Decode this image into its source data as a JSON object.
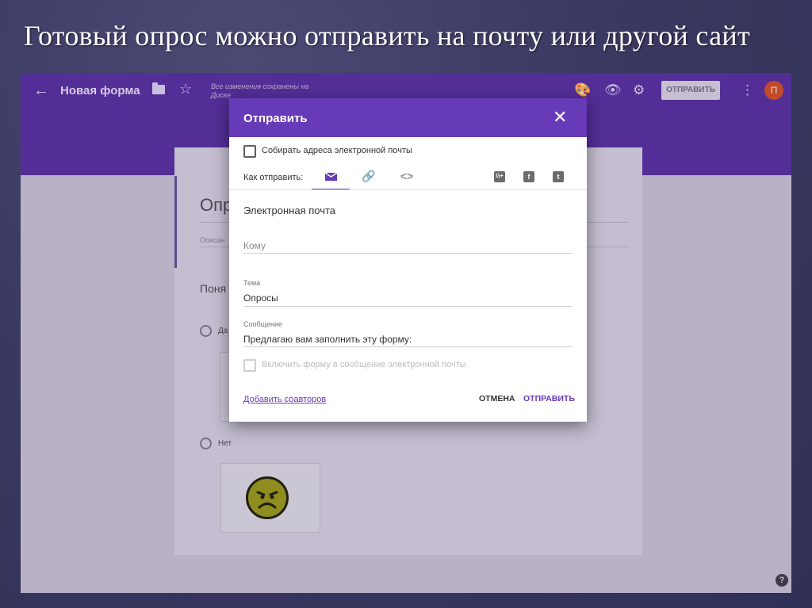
{
  "slide": {
    "title": "Готовый опрос можно отправить на почту или другой сайт"
  },
  "header": {
    "back_icon": "arrow-left-icon",
    "form_name": "Новая форма",
    "save_status": "Все изменения сохранены на Диске",
    "send_label": "ОТПРАВИТЬ",
    "avatar_letter": "П",
    "accent_color": "#673ab7"
  },
  "form": {
    "title_fragment": "Опр",
    "description_fragment": "Описан",
    "question_fragment": "Поня",
    "options": [
      {
        "label": "Да"
      },
      {
        "label": "Нет"
      }
    ]
  },
  "dialog": {
    "title": "Отправить",
    "collect_emails_label": "Собирать адреса электронной почты",
    "collect_emails_checked": false,
    "send_via_label": "Как отправить:",
    "tabs": [
      {
        "icon": "email-icon",
        "active": true
      },
      {
        "icon": "link-icon",
        "active": false
      },
      {
        "icon": "embed-code-icon",
        "active": false
      }
    ],
    "social": [
      {
        "icon": "google-plus-icon",
        "glyph": "G+"
      },
      {
        "icon": "facebook-icon",
        "glyph": "f"
      },
      {
        "icon": "twitter-icon",
        "glyph": "t"
      }
    ],
    "section_title": "Электронная почта",
    "to_placeholder": "Кому",
    "subject_label": "Тема",
    "subject_value": "Опросы",
    "message_label": "Сообщение",
    "message_value": "Предлагаю вам заполнить эту форму:",
    "include_form_label": "Включить форму в сообщение электронной почты",
    "include_form_checked": false,
    "add_collaborators": "Добавить соавторов",
    "cancel_label": "ОТМЕНА",
    "send_label": "ОТПРАВИТЬ"
  }
}
